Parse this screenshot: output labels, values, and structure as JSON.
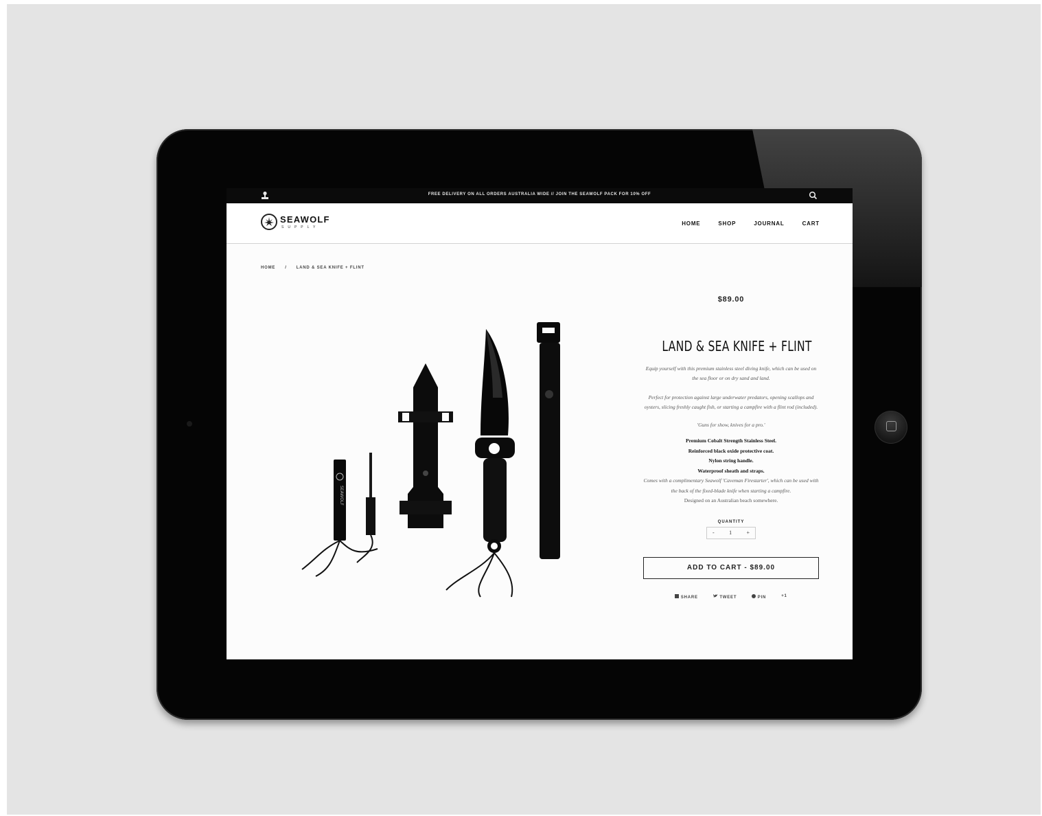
{
  "topbar": {
    "promo": "FREE DELIVERY ON ALL ORDERS AUSTRALIA WIDE // JOIN THE SEAWOLF PACK FOR 10% OFF"
  },
  "logo": {
    "word": "SEAWOLF",
    "sub": "SUPPLY"
  },
  "nav": {
    "home": "HOME",
    "shop": "SHOP",
    "journal": "JOURNAL",
    "cart": "CART"
  },
  "breadcrumb": {
    "home": "HOME",
    "separator": "/",
    "current": "LAND & SEA KNIFE + FLINT"
  },
  "product": {
    "price": "$89.00",
    "title": "LAND & SEA KNIFE + FLINT",
    "desc1": "Equip yourself with this premium stainless steel diving knife, which can be used on the sea floor or on dry sand and land.",
    "desc2": "Perfect for protection against large underwater predators, opening scallops and oysters, slicing freshly caught fish, or starting a campfire with a flint rod (included).",
    "quote": "'Guns for show, knives for a pro.'",
    "f1": "Premium Cobalt Strength Stainless Steel.",
    "f2": "Reinforced black oxide protective coat.",
    "f3": "Nylon string handle.",
    "f4": "Waterproof sheath and straps.",
    "f5": "Comes with a complimentary Seawolf 'Caveman Firestarter', which can be used with the back of the fixed-blade knife when starting a campfire.",
    "f6": "Designed on an Australian beach somewhere.",
    "quantity_label": "QUANTITY",
    "qty_minus": "-",
    "qty_value": "1",
    "qty_plus": "+",
    "add_to_cart": "ADD TO CART - $89.00"
  },
  "share": {
    "facebook": "SHARE",
    "twitter": "TWEET",
    "pinterest": "PIN",
    "gplus": "+1"
  }
}
